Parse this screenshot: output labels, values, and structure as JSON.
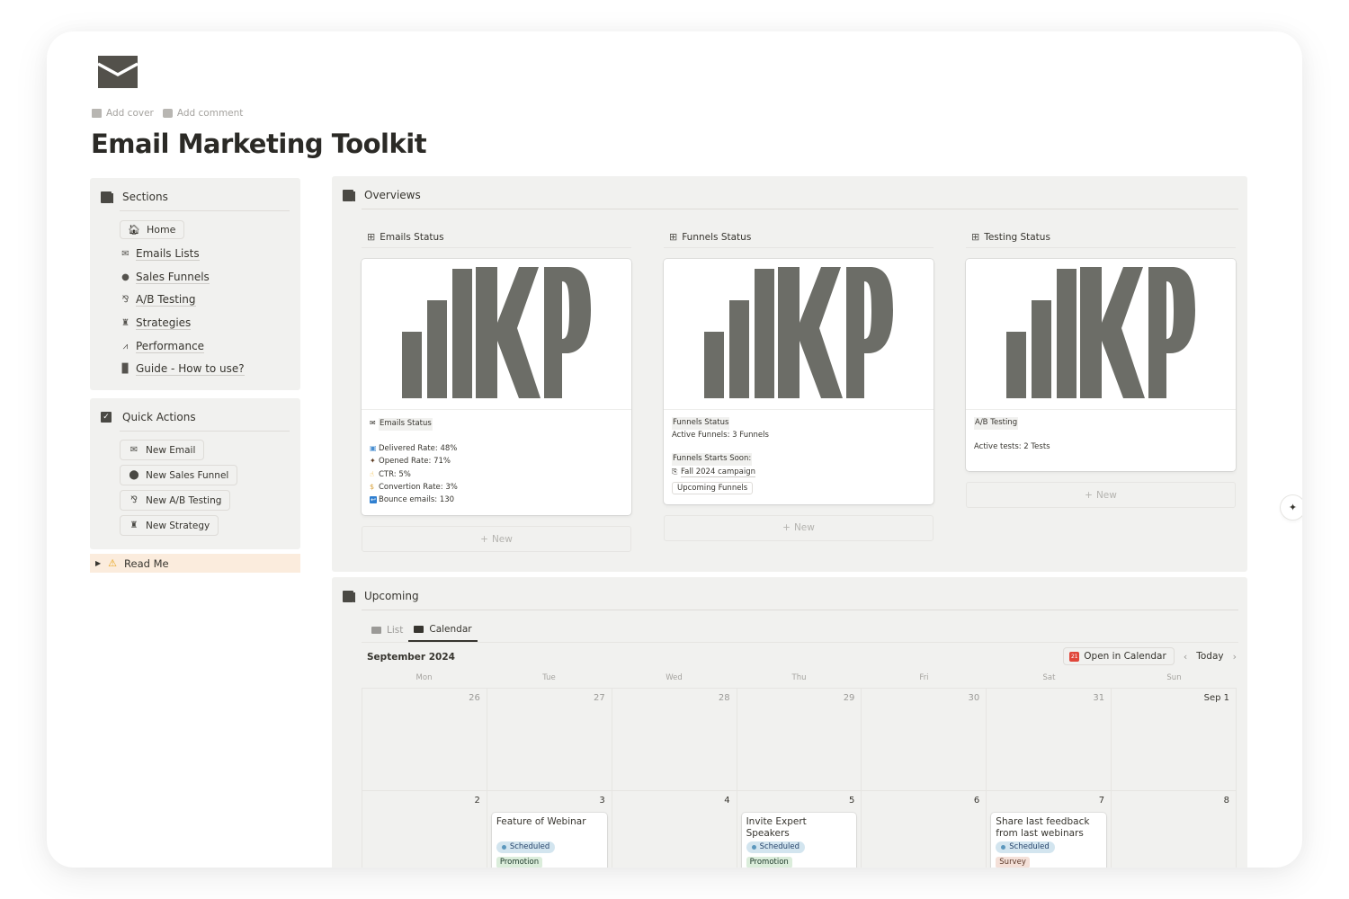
{
  "page": {
    "icon": "envelope-icon",
    "title": "Email Marketing Toolkit",
    "add_cover": "Add cover",
    "add_comment": "Add comment"
  },
  "sections": {
    "title": "Sections",
    "items": [
      {
        "label": "Home",
        "icon": "home-icon"
      },
      {
        "label": "Emails Lists",
        "icon": "email-link-icon"
      },
      {
        "label": "Sales Funnels",
        "icon": "funnel-link-icon"
      },
      {
        "label": "A/B Testing",
        "icon": "ab-test-link-icon"
      },
      {
        "label": "Strategies",
        "icon": "strategy-link-icon"
      },
      {
        "label": "Performance",
        "icon": "chart-link-icon"
      },
      {
        "label": "Guide - How to use?",
        "icon": "guide-link-icon"
      }
    ]
  },
  "quick_actions": {
    "title": "Quick Actions",
    "buttons": [
      {
        "label": "New Email",
        "icon": "envelope-icon"
      },
      {
        "label": "New Sales Funnel",
        "icon": "funnel-icon"
      },
      {
        "label": "New A/B Testing",
        "icon": "ab-test-icon"
      },
      {
        "label": "New Strategy",
        "icon": "chess-rook-icon"
      }
    ]
  },
  "readme": {
    "label": "Read Me",
    "icon": "warning-icon"
  },
  "overviews": {
    "title": "Overviews",
    "columns": [
      {
        "title": "Emails Status",
        "cover": "KPI",
        "card_title": "Emails Status",
        "lines": [
          {
            "icon": "inbox-tray-icon",
            "text": "Delivered Rate: 48%"
          },
          {
            "icon": "eye-icon",
            "text": "Opened Rate: 71%"
          },
          {
            "icon": "pointing-hand-icon",
            "text": "CTR: 5%"
          },
          {
            "icon": "money-bag-icon",
            "text": "Convertion Rate: 3%"
          },
          {
            "icon": "return-arrow-icon",
            "text": "Bounce emails: 130"
          }
        ],
        "new_label": "New"
      },
      {
        "title": "Funnels Status",
        "cover": "KPI",
        "card_title": "Funnels Status",
        "active": "Active Funnels: 3 Funnels",
        "soon_label": "Funnels Starts Soon:",
        "soon_link": "Fall 2024 campaign",
        "tag": "Upcoming Funnels",
        "new_label": "New"
      },
      {
        "title": "Testing Status",
        "cover": "KPI",
        "card_title": "A/B Testing",
        "active": "Active tests: 2 Tests",
        "new_label": "New"
      }
    ]
  },
  "upcoming": {
    "title": "Upcoming",
    "tabs": [
      {
        "label": "List",
        "active": false
      },
      {
        "label": "Calendar",
        "active": true
      }
    ],
    "month": "September 2024",
    "open_in_calendar": "Open in Calendar",
    "today": "Today",
    "weekdays": [
      "Mon",
      "Tue",
      "Wed",
      "Thu",
      "Fri",
      "Sat",
      "Sun"
    ],
    "days": [
      "26",
      "27",
      "28",
      "29",
      "30",
      "31",
      "Sep 1",
      "2",
      "3",
      "4",
      "5",
      "6",
      "7",
      "8"
    ],
    "events": {
      "8": {
        "title": "Feature of Webinar",
        "status": "Scheduled",
        "tag": "Promotion",
        "tag_type": "promo"
      },
      "10": {
        "title": "Invite Expert Speakers",
        "status": "Scheduled",
        "tag": "Promotion",
        "tag_type": "promo"
      },
      "12": {
        "title": "Share last feedback from last webinars",
        "status": "Scheduled",
        "tag": "Survey",
        "tag_type": "survey"
      }
    }
  },
  "colors": {
    "panel_bg": "#f1f1ef",
    "readme_bg": "#fbecdd",
    "kpi_gray": "#6c6d67",
    "status_blue": "#d3e5ef",
    "tag_promotion": "#dbeddb",
    "tag_survey": "#f4e0d8"
  }
}
